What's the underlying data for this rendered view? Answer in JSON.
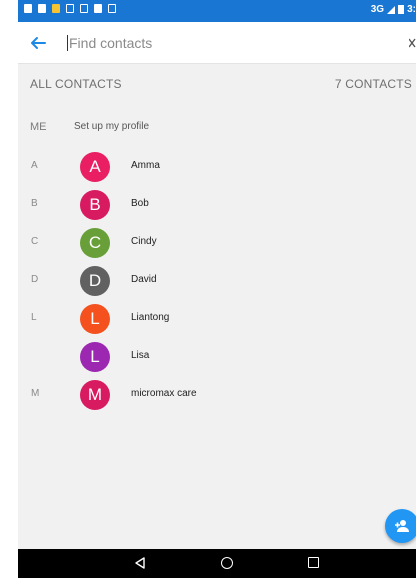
{
  "status_bar": {
    "network": "3G",
    "clock": "3:"
  },
  "search": {
    "placeholder": "Find contacts"
  },
  "section": {
    "title": "ALL CONTACTS",
    "count": "7 CONTACTS"
  },
  "profile": {
    "section_letter": "ME",
    "label": "Set up my profile"
  },
  "contacts": [
    {
      "section_letter": "A",
      "initial": "A",
      "name": "Amma",
      "color": "#e91e63"
    },
    {
      "section_letter": "B",
      "initial": "B",
      "name": "Bob",
      "color": "#d81b60"
    },
    {
      "section_letter": "C",
      "initial": "C",
      "name": "Cindy",
      "color": "#689f38"
    },
    {
      "section_letter": "D",
      "initial": "D",
      "name": "David",
      "color": "#616161"
    },
    {
      "section_letter": "L",
      "initial": "L",
      "name": "Liantong",
      "color": "#f4511e"
    },
    {
      "section_letter": "",
      "initial": "L",
      "name": "Lisa",
      "color": "#9c27b0"
    },
    {
      "section_letter": "M",
      "initial": "M",
      "name": "micromax care",
      "color": "#d81b60"
    }
  ],
  "colors": {
    "status_bar": "#1976d2",
    "accent": "#2196f3",
    "background": "#f1f1f1"
  },
  "icons": {
    "back": "arrow-left-icon",
    "clear": "close-icon",
    "fab": "add-contact-icon",
    "nav": [
      "nav-back-icon",
      "nav-home-icon",
      "nav-recents-icon"
    ]
  }
}
